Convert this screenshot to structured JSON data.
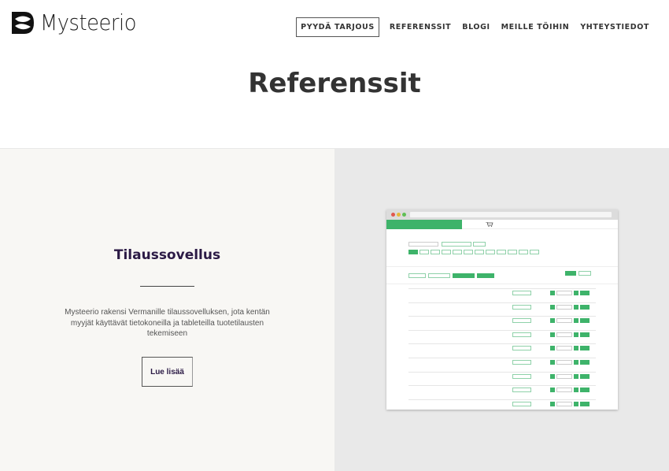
{
  "brand": {
    "name": "Mysteerio"
  },
  "nav": {
    "cta": "PYYDÄ TARJOUS",
    "items": [
      "REFERENSSIT",
      "BLOGI",
      "MEILLE TÖIHIN",
      "YHTEYSTIEDOT"
    ]
  },
  "page": {
    "title": "Referenssit"
  },
  "case": {
    "title": "Tilaussovellus",
    "description": "Mysteerio rakensi Vermanille tilaussovelluksen, jota kentän myyjät käyttävät tietokoneilla ja tableteilla tuotetilausten tekemiseen",
    "button": "Lue lisää"
  },
  "colors": {
    "accent_green": "#3eb36a",
    "title_purple": "#2b1a45",
    "left_bg": "#f8f7f4",
    "right_bg": "#e9e9e9"
  },
  "icons": [
    "mysteerio-logo-icon",
    "cart-icon"
  ]
}
